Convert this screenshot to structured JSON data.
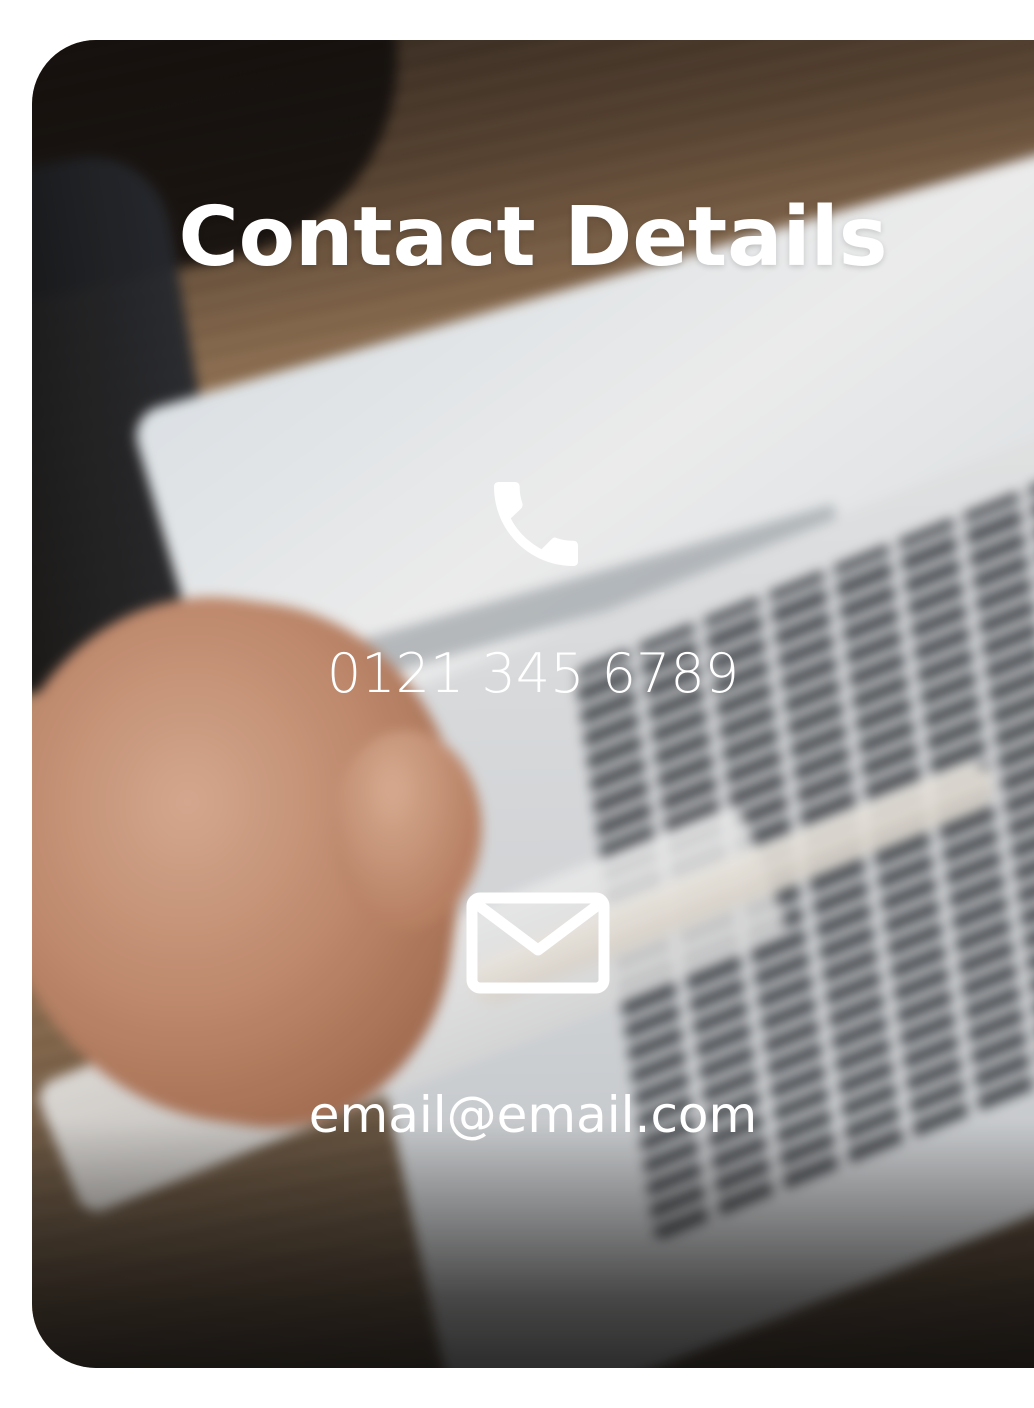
{
  "card": {
    "title": "Contact Details",
    "phone": {
      "icon": "phone-icon",
      "value": "0121 345 6789"
    },
    "email": {
      "icon": "mail-icon",
      "value": "email@email.com"
    }
  },
  "colors": {
    "text": "#ffffff",
    "page_background": "#ffffff"
  }
}
